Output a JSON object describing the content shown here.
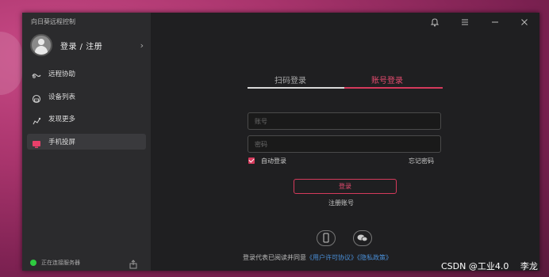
{
  "app": {
    "title": "向日葵远程控制"
  },
  "profile": {
    "label": "登录 / 注册",
    "chevron": "›"
  },
  "nav": [
    {
      "label": "远程协助",
      "icon": "remote-assist-icon",
      "active": false
    },
    {
      "label": "设备列表",
      "icon": "device-list-icon",
      "active": false
    },
    {
      "label": "发现更多",
      "icon": "discover-icon",
      "active": false
    },
    {
      "label": "手机投屏",
      "icon": "phone-cast-icon",
      "active": true
    }
  ],
  "status": {
    "text": "正在连接服务器"
  },
  "tabs": [
    {
      "label": "扫码登录",
      "active": false
    },
    {
      "label": "账号登录",
      "active": true
    }
  ],
  "form": {
    "account_placeholder": "账号",
    "password_placeholder": "密码",
    "auto_login_label": "自动登录",
    "auto_login_checked": true,
    "forgot_password": "忘记密码",
    "login_button": "登录",
    "register": "注册账号"
  },
  "footer": {
    "prefix": "登录代表已阅读并同意",
    "user_agreement": "《用户许可协议》",
    "privacy_policy": "《隐私政策》"
  },
  "watermark": "CSDN @工业4.0　 李龙",
  "colors": {
    "accent": "#d53a5c",
    "link": "#4a8fd8",
    "status_ok": "#2ecc40",
    "sidebar_bg": "#2b2b2d",
    "content_bg": "#1f1f21"
  }
}
